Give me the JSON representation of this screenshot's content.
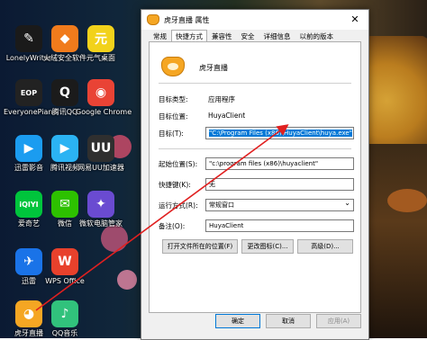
{
  "desktop": {
    "icons": [
      {
        "label": "LonelyWriter",
        "icon": "lonelywriter-icon",
        "color": "#1a1a1a",
        "glyph": "✎"
      },
      {
        "label": "火绒安全软件",
        "icon": "huorong-icon",
        "color": "#f07b1c",
        "glyph": "◆"
      },
      {
        "label": "元气桌面",
        "icon": "yuanqi-icon",
        "color": "#f2d21b",
        "glyph": "元"
      },
      {
        "label": "EveryonePiano",
        "icon": "piano-icon",
        "color": "#222222",
        "glyph": "EOP"
      },
      {
        "label": "腾讯QQ",
        "icon": "qq-icon",
        "color": "#1b1b1b",
        "glyph": "Q"
      },
      {
        "label": "Google Chrome",
        "icon": "chrome-icon",
        "color": "#e94335",
        "glyph": "◉"
      },
      {
        "label": "迅雷影音",
        "icon": "xunlei-player-icon",
        "color": "#1b9cf0",
        "glyph": "▶"
      },
      {
        "label": "腾讯视频",
        "icon": "tencent-video-icon",
        "color": "#2bb3f3",
        "glyph": "▶"
      },
      {
        "label": "网易UU加速器",
        "icon": "uu-icon",
        "color": "#2f2f2f",
        "glyph": "UU"
      },
      {
        "label": "爱奇艺",
        "icon": "iqiyi-icon",
        "color": "#00c43c",
        "glyph": "iQIYI"
      },
      {
        "label": "微信",
        "icon": "wechat-icon",
        "color": "#2dc100",
        "glyph": "✉"
      },
      {
        "label": "微软电脑管家",
        "icon": "ms-pc-manager-icon",
        "color": "#6a4bd1",
        "glyph": "✦"
      },
      {
        "label": "迅雷",
        "icon": "xunlei-icon",
        "color": "#1a73e8",
        "glyph": "✈"
      },
      {
        "label": "WPS Office",
        "icon": "wps-icon",
        "color": "#e8412c",
        "glyph": "W"
      },
      {
        "label": "虎牙直播",
        "icon": "huya-icon",
        "color": "#f5a623",
        "glyph": "◕"
      },
      {
        "label": "QQ音乐",
        "icon": "qqmusic-icon",
        "color": "#31c27c",
        "glyph": "♪"
      }
    ]
  },
  "dialog": {
    "title": "虎牙直播 属性",
    "close": "✕",
    "tabs": [
      "常规",
      "快捷方式",
      "兼容性",
      "安全",
      "详细信息",
      "以前的版本"
    ],
    "active_tab_index": 1,
    "app_name": "虎牙直播",
    "target_type_label": "目标类型:",
    "target_type_value": "应用程序",
    "target_location_label": "目标位置:",
    "target_location_value": "HuyaClient",
    "target_label": "目标(T):",
    "target_value": "\"C:\\Program Files (x86)\\HuyaClient\\huya.exe\"",
    "start_in_label": "起始位置(S):",
    "start_in_value": "\"c:\\program files (x86)\\huyaclient\"",
    "shortcut_key_label": "快捷键(K):",
    "shortcut_key_value": "无",
    "run_label": "运行方式(R):",
    "run_value": "常规窗口",
    "comment_label": "备注(O):",
    "comment_value": "HuyaClient",
    "btn_open_location": "打开文件所在的位置(F)",
    "btn_change_icon": "更改图标(C)...",
    "btn_advanced": "高级(D)...",
    "btn_ok": "确定",
    "btn_cancel": "取消",
    "btn_apply": "应用(A)"
  },
  "colors": {
    "accent": "#0078d7",
    "arrow": "#e02020"
  }
}
